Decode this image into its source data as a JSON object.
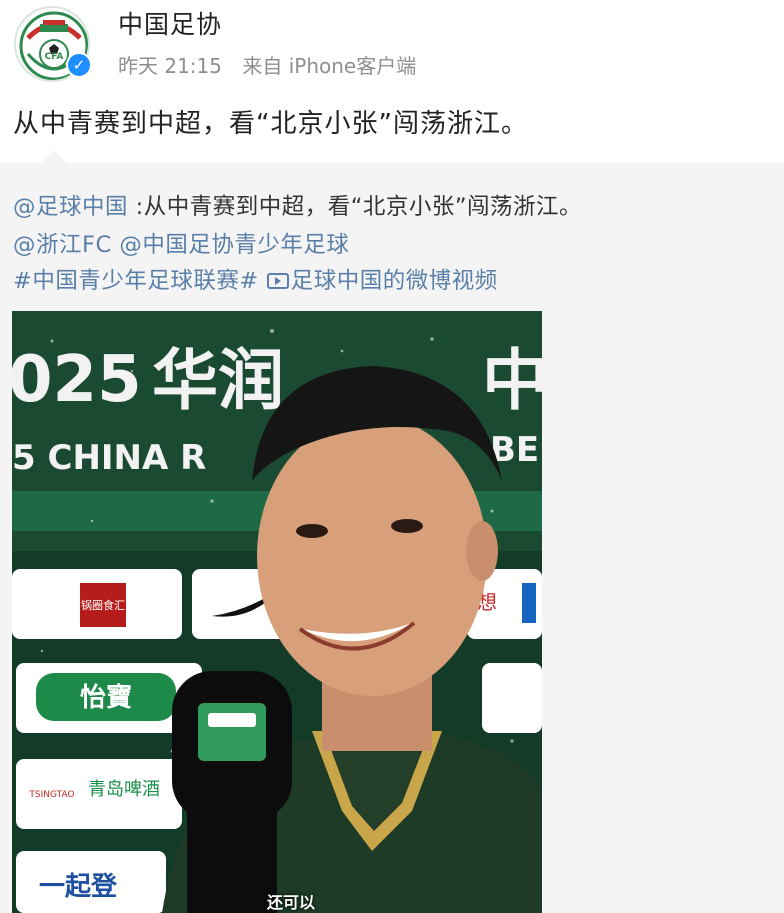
{
  "header": {
    "user_name": "中国足协",
    "time": "昨天 21:15",
    "source": "来自 iPhone客户端",
    "avatar_text": "CFA"
  },
  "post": {
    "text": "从中青赛到中超，看“北京小张”闯荡浙江。"
  },
  "repost": {
    "author": "@足球中国",
    "text": " :从中青赛到中超，看“北京小张”闯荡浙江。",
    "mention_1": "@浙江FC",
    "mention_2": "@中国足协青少年足球",
    "topic": "#中国青少年足球联赛#",
    "video_link": "足球中国的微博视频"
  },
  "video": {
    "banner_number": "025",
    "banner_chars": "华润",
    "banner_chars_right": "中",
    "banner_english": "5 CHINA R",
    "banner_english_right": "BE",
    "sponsor_1": "锅圈食汇",
    "sponsor_2": "怡寶",
    "sponsor_3": "青岛啤酒",
    "sponsor_3_en": "TSINGTAO",
    "sponsor_4": "一起登",
    "sponsor_right": "想",
    "subtitle": "还可以"
  },
  "colors": {
    "link": "#5a7fa8",
    "verify": "#1d8fff",
    "card_bg": "#f4f4f4"
  }
}
